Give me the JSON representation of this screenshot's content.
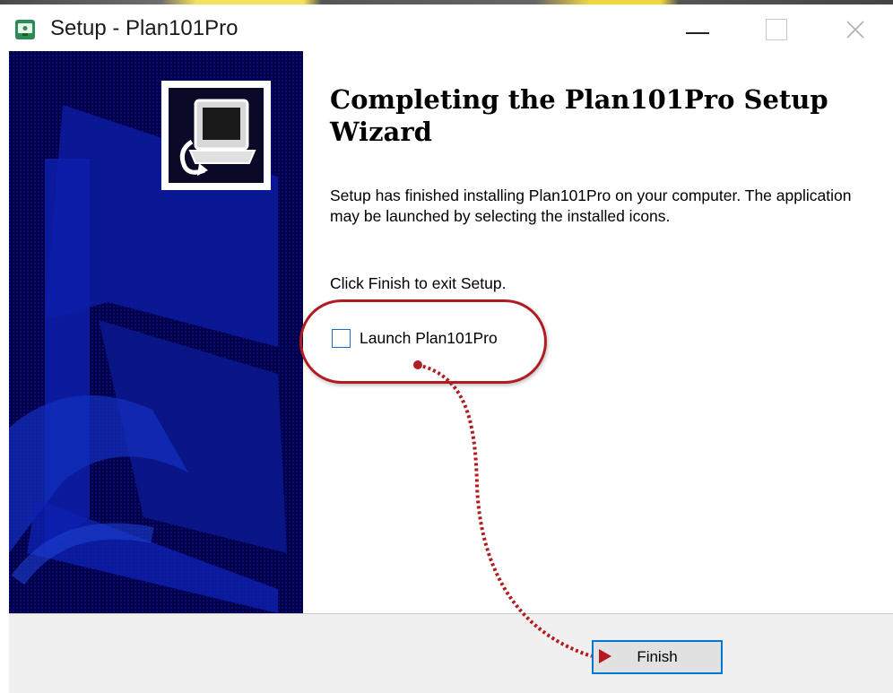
{
  "window": {
    "title": "Setup - Plan101Pro",
    "icon": "setup-app-icon",
    "controls": [
      "minimize-icon",
      "maximize-icon",
      "close-icon"
    ]
  },
  "sidebar": {
    "background_color": "#000050",
    "logo_icon": "computer-install-icon"
  },
  "main": {
    "heading": "Completing the Plan101Pro Setup Wizard",
    "paragraph": "Setup has finished installing Plan101Pro on your computer. The application may be launched by selecting the installed icons.",
    "instruction": "Click Finish to exit Setup.",
    "launch_checkbox": {
      "label": "Launch Plan101Pro",
      "checked": false
    }
  },
  "footer": {
    "finish_label": "Finish"
  },
  "annotation": {
    "color": "#b01c20"
  }
}
